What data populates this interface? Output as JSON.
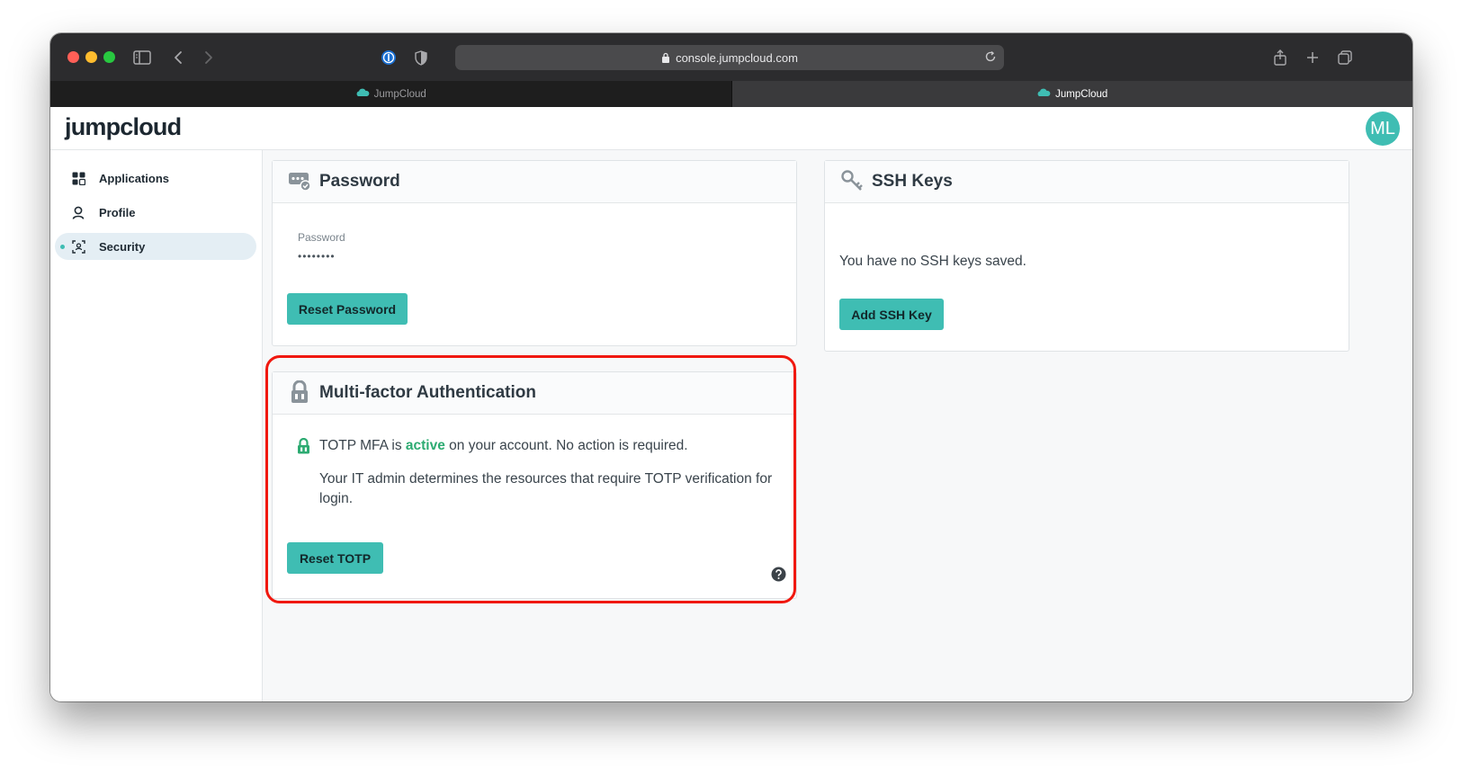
{
  "browser": {
    "url": "console.jumpcloud.com",
    "tabs": [
      {
        "label": "JumpCloud",
        "active": false
      },
      {
        "label": "JumpCloud",
        "active": true
      }
    ]
  },
  "app": {
    "logo": "jumpcloud",
    "avatar_initials": "ML",
    "avatar_color": "#3fbdb3",
    "accent_color": "#3fbdb3"
  },
  "sidebar": {
    "items": [
      {
        "label": "Applications",
        "icon": "grid-icon",
        "active": false
      },
      {
        "label": "Profile",
        "icon": "user-icon",
        "active": false
      },
      {
        "label": "Security",
        "icon": "scan-face-icon",
        "active": true
      }
    ]
  },
  "password_card": {
    "title": "Password",
    "field_label": "Password",
    "field_value": "••••••••",
    "button": "Reset Password"
  },
  "ssh_card": {
    "title": "SSH Keys",
    "empty_text": "You have no SSH keys saved.",
    "button": "Add SSH Key"
  },
  "mfa_card": {
    "title": "Multi-factor Authentication",
    "status_prefix": "TOTP MFA is ",
    "status_word": "active",
    "status_suffix": " on your account. No action is required.",
    "status_color": "#2dab72",
    "description": "Your IT admin determines the resources that require TOTP verification for login.",
    "button": "Reset TOTP",
    "highlight_color": "#f0180f"
  }
}
